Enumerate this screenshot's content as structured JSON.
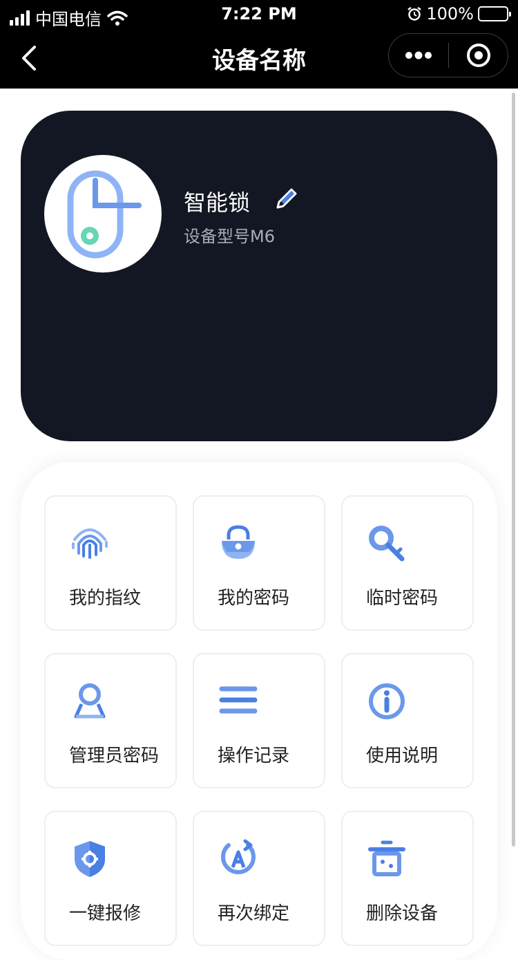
{
  "status_bar": {
    "carrier": "中国电信",
    "time": "7:22 PM",
    "battery": "100%"
  },
  "nav": {
    "title": "设备名称"
  },
  "device": {
    "name": "智能锁",
    "model": "设备型号M6"
  },
  "menu": [
    {
      "label": "我的指纹",
      "icon": "fingerprint-icon"
    },
    {
      "label": "我的密码",
      "icon": "lock-icon"
    },
    {
      "label": "临时密码",
      "icon": "key-search-icon"
    },
    {
      "label": "管理员密码",
      "icon": "admin-user-icon"
    },
    {
      "label": "操作记录",
      "icon": "list-icon"
    },
    {
      "label": "使用说明",
      "icon": "info-icon"
    },
    {
      "label": "一键报修",
      "icon": "shield-gear-icon"
    },
    {
      "label": "再次绑定",
      "icon": "rebind-icon"
    },
    {
      "label": "删除设备",
      "icon": "trash-icon"
    }
  ],
  "colors": {
    "accent": "#4a7fe3",
    "accent_light": "#8fb4f5",
    "card_bg": "#121723",
    "green": "#66d6b5"
  }
}
